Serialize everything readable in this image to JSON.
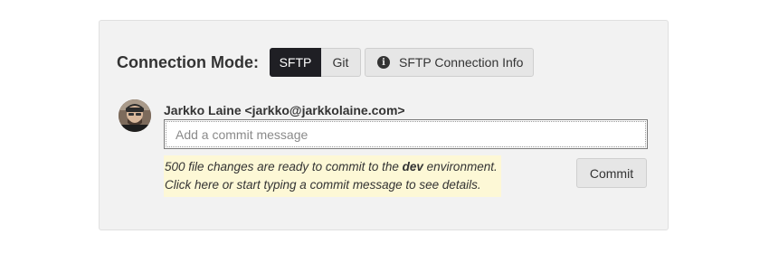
{
  "connection": {
    "label": "Connection Mode:",
    "modes": [
      {
        "label": "SFTP",
        "active": true
      },
      {
        "label": "Git",
        "active": false
      }
    ],
    "info_button_label": "SFTP Connection Info",
    "info_icon": "info-circle-icon"
  },
  "commit": {
    "author": "Jarkko Laine <jarkko@jarkkolaine.com>",
    "avatar_icon": "user-avatar",
    "input_value": "",
    "input_placeholder": "Add a commit message",
    "notice_prefix": "500 file changes are ready to commit to the ",
    "notice_env": "dev",
    "notice_suffix": " environment.",
    "notice_line2": "Click here or start typing a commit message to see details.",
    "button_label": "Commit"
  },
  "colors": {
    "panel_bg": "#f2f2f2",
    "active_mode_bg": "#1f1f24",
    "notice_bg": "#fdf8d6"
  }
}
